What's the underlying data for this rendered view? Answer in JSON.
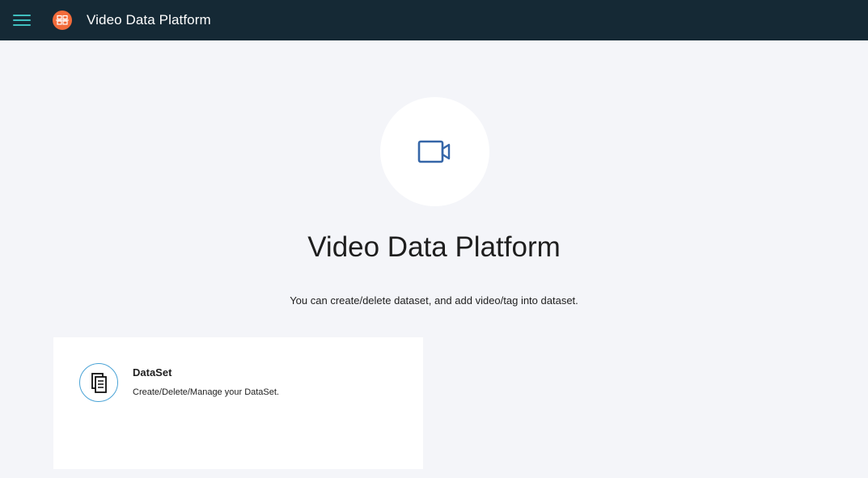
{
  "header": {
    "menu_icon": "hamburger-icon",
    "logo_icon": "app-logo-icon",
    "title": "Video Data Platform",
    "colors": {
      "background": "#152935",
      "menu": "#3fbfbf",
      "logo": "#f26b3a"
    }
  },
  "hero": {
    "icon": "video-camera-icon",
    "title": "Video Data Platform",
    "subtitle": "You can create/delete dataset, and add video/tag into dataset."
  },
  "cards": [
    {
      "icon": "dataset-documents-icon",
      "title": "DataSet",
      "description": "Create/Delete/Manage your DataSet."
    }
  ]
}
